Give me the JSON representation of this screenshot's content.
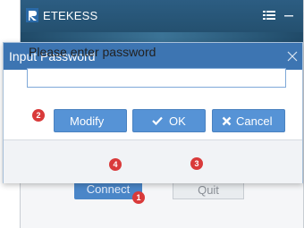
{
  "app": {
    "title": "ETEKESS"
  },
  "background_buttons": {
    "connect_label": "Connect",
    "quit_label": "Quit"
  },
  "dialog": {
    "title": "Input Password",
    "prompt": "Please enter password",
    "password_value": "",
    "buttons": {
      "modify_label": "Modify",
      "ok_label": "OK",
      "cancel_label": "Cancel"
    }
  },
  "badges": [
    "1",
    "2",
    "3",
    "4"
  ],
  "icons": [
    "logo-icon",
    "menu-icon",
    "minimize-icon",
    "close-icon",
    "checkmark-icon",
    "x-icon"
  ],
  "colors": {
    "accent": "#3d75b2",
    "button": "#5693d6",
    "badge": "#d93a3a",
    "titlebar": "#2c5d82"
  }
}
